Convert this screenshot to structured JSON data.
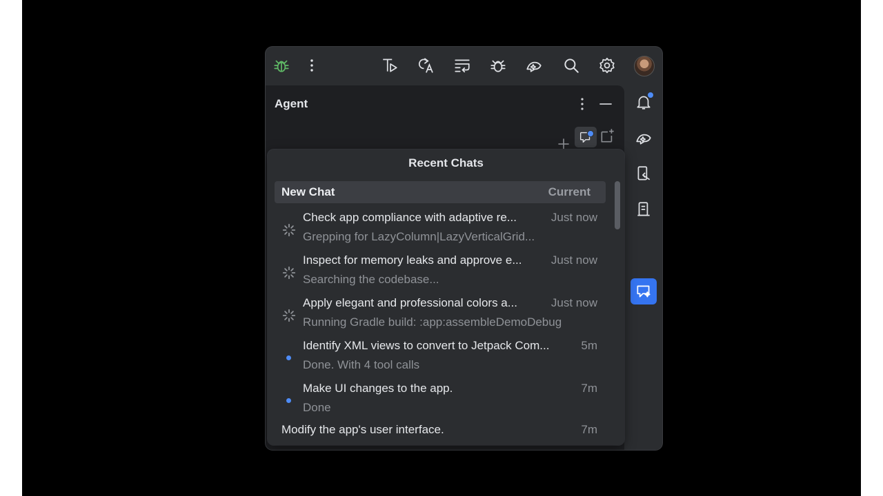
{
  "toolbar": {
    "icons": [
      "bug-icon",
      "more-vertical-icon",
      "run-test-icon",
      "translate-icon",
      "wrap-lines-icon",
      "debug-icon",
      "gemini-icon",
      "search-icon",
      "settings-icon",
      "avatar"
    ]
  },
  "panel": {
    "title": "Agent",
    "sub_icons": [
      "add-icon",
      "chat-history-icon",
      "new-window-icon"
    ]
  },
  "right_strip": {
    "icons": [
      "notifications-icon",
      "gemini-icon",
      "device-manager-icon",
      "running-devices-icon",
      "agent-chat-icon"
    ]
  },
  "popup": {
    "title": "Recent Chats",
    "new_chat": {
      "label": "New Chat",
      "status": "Current"
    },
    "chats": [
      {
        "title": "Check app compliance with adaptive re...",
        "time": "Just now",
        "subtitle": "Grepping for LazyColumn|LazyVerticalGrid...",
        "state": "running"
      },
      {
        "title": "Inspect for memory leaks and approve e...",
        "time": "Just now",
        "subtitle": "Searching the codebase...",
        "state": "running"
      },
      {
        "title": "Apply elegant and professional colors a...",
        "time": "Just now",
        "subtitle": "Running Gradle build: :app:assembleDemoDebug",
        "state": "running"
      },
      {
        "title": "Identify XML views to convert to Jetpack Com...",
        "time": "5m",
        "subtitle": "Done. With 4 tool calls",
        "state": "unread"
      },
      {
        "title": "Make UI changes to the app.",
        "time": "7m",
        "subtitle": "Done",
        "state": "unread"
      }
    ],
    "last_chat": {
      "title": "Modify the app's user interface.",
      "time": "7m"
    }
  },
  "colors": {
    "accent": "#3574f0",
    "badge": "#4e8cf7",
    "bug_green": "#5fb865",
    "background": "#2b2d30"
  }
}
